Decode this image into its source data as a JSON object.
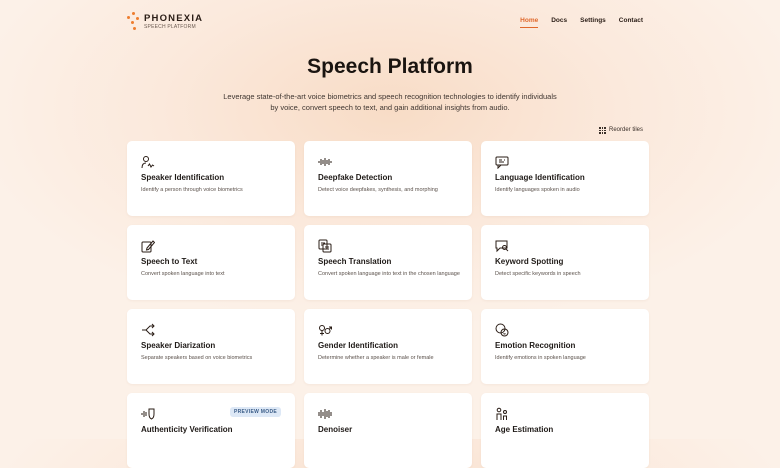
{
  "brand": {
    "name": "PHONEXIA",
    "subtitle": "SPEECH PLATFORM",
    "accent": "#e0682b"
  },
  "nav": {
    "items": [
      "Home",
      "Docs",
      "Settings",
      "Contact"
    ],
    "active": "Home"
  },
  "hero": {
    "title": "Speech Platform",
    "description": "Leverage state-of-the-art voice biometrics and speech recognition technologies to identify individuals by voice, convert speech to text, and gain additional insights from audio."
  },
  "reorder": {
    "label": "Reorder tiles",
    "icon": "grid-icon"
  },
  "tiles": [
    {
      "name": "Speaker Identification",
      "desc": "Identify a person through voice biometrics",
      "icon": "person-voice-icon"
    },
    {
      "name": "Deepfake Detection",
      "desc": "Detect voice deepfakes, synthesis, and morphing",
      "icon": "waveform-alert-icon"
    },
    {
      "name": "Language Identification",
      "desc": "Identify languages spoken in audio",
      "icon": "language-chat-icon"
    },
    {
      "name": "Speech to Text",
      "desc": "Convert spoken language into text",
      "icon": "edit-icon"
    },
    {
      "name": "Speech Translation",
      "desc": "Convert spoken language into text in the chosen language",
      "icon": "translate-icon"
    },
    {
      "name": "Keyword Spotting",
      "desc": "Detect specific keywords in speech",
      "icon": "message-search-icon"
    },
    {
      "name": "Speaker Diarization",
      "desc": "Separate speakers based on voice biometrics",
      "icon": "split-icon"
    },
    {
      "name": "Gender Identification",
      "desc": "Determine whether a speaker is male or female",
      "icon": "gender-icon"
    },
    {
      "name": "Emotion Recognition",
      "desc": "Identify emotions in spoken language",
      "icon": "emotion-icon"
    },
    {
      "name": "Authenticity Verification",
      "desc": "",
      "icon": "voice-shield-icon",
      "badge": "PREVIEW MODE"
    },
    {
      "name": "Denoiser",
      "desc": "",
      "icon": "waveform-icon"
    },
    {
      "name": "Age Estimation",
      "desc": "",
      "icon": "people-age-icon"
    }
  ]
}
